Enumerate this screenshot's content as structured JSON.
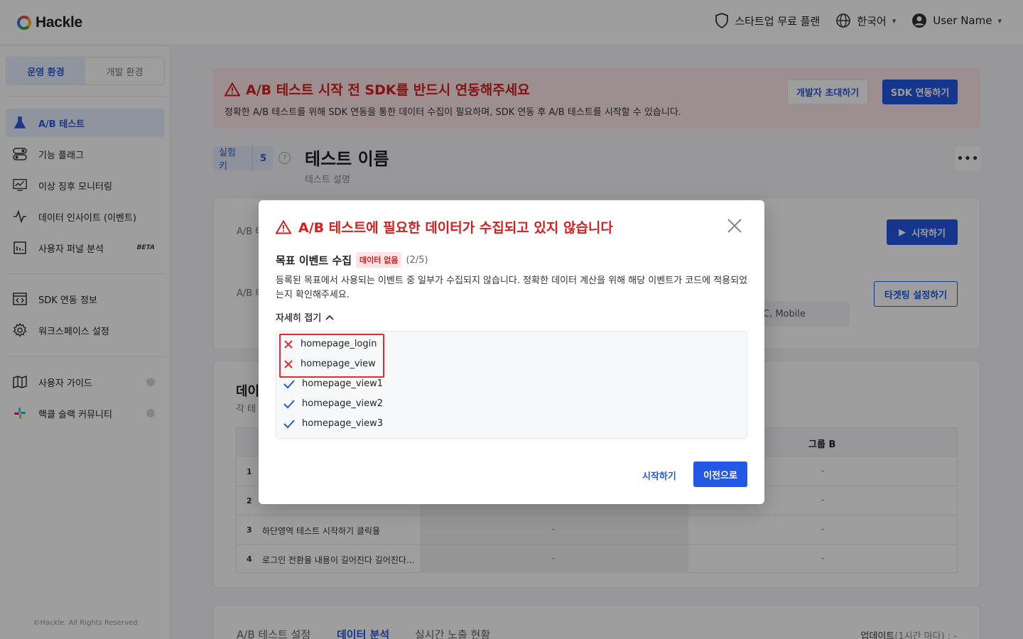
{
  "header": {
    "logo": "Hackle",
    "plan": "스타트업 무료 플랜",
    "language": "한국어",
    "user": "User Name"
  },
  "sidebar": {
    "env_tabs": [
      "운영 환경",
      "개발 환경"
    ],
    "items": [
      {
        "label": "A/B 테스트",
        "icon": "flask-icon"
      },
      {
        "label": "기능 플래그",
        "icon": "toggle-icon"
      },
      {
        "label": "이상 징후 모니터링",
        "icon": "monitor-chart-icon"
      },
      {
        "label": "데이터 인사이트 (이벤트)",
        "icon": "pulse-icon"
      },
      {
        "label": "사용자 퍼널 분석",
        "icon": "bar-chart-icon",
        "badge": "BETA"
      },
      {
        "label": "SDK 연동 정보",
        "icon": "code-window-icon"
      },
      {
        "label": "워크스페이스 설정",
        "icon": "gear-icon"
      },
      {
        "label": "사용자 가이드",
        "icon": "map-icon"
      },
      {
        "label": "핵클 슬랙 커뮤니티",
        "icon": "slack-icon"
      }
    ],
    "copyright": "©Hackle. All Rights Reserved"
  },
  "banner": {
    "title": "A/B 테스트 시작 전 SDK를 반드시 연동해주세요",
    "desc": "정확한 A/B 테스트를 위해 SDK 연동을 통한 데이터 수집이 필요하며, SDK 연동 후 A/B 테스트를 시작할 수 있습니다.",
    "invite_button": "개발자 초대하기",
    "sdk_button": "SDK 연동하기"
  },
  "test": {
    "key_label": "실험 키",
    "key_value": "5",
    "help": "?",
    "title": "테스트 이름",
    "desc": "테스트 설명",
    "more": "•••"
  },
  "info_card": {
    "label1": "A/B 테",
    "label2": "A/B 테",
    "start_button": "시작하기",
    "target_button": "타겟팅 설정하기",
    "platform": "C, Mobile"
  },
  "data_section": {
    "title": "데이",
    "subtitle": "각 테",
    "group_b": "그룹 B",
    "rows": [
      {
        "num": "1",
        "name": "",
        "a": "",
        "b": "-"
      },
      {
        "num": "2",
        "name": "",
        "a": "",
        "b": "-"
      },
      {
        "num": "3",
        "name": "하단영역 테스트 시작하기 클릭율",
        "a": "-",
        "b": "-"
      },
      {
        "num": "4",
        "name": "로그인 전환율 내용이 길어진다 길어진다...",
        "a": "-",
        "b": "-"
      }
    ]
  },
  "bottom_tabs": {
    "tabs": [
      "A/B 테스트 설정",
      "데이터 분석",
      "실시간 노출 현황"
    ],
    "update_label": "업데이트",
    "update_period": "(1시간 마다) : -"
  },
  "modal": {
    "title": "A/B 테스트에 필요한 데이터가 수집되고 있지 않습니다",
    "subtitle": "목표 이벤트 수집",
    "badge": "데이터 없음",
    "count": "(2/5)",
    "desc": "등록된 목표에서 사용되는 이벤트 중 일부가 수집되지 않습니다. 정확한 데이터 계산을 위해 해당 이벤트가 코드에 적용되었는지 확인해주세요.",
    "toggle": "자세히 접기",
    "events": [
      {
        "name": "homepage_login",
        "status": "missing"
      },
      {
        "name": "homepage_view",
        "status": "missing"
      },
      {
        "name": "homepage_view1",
        "status": "ok"
      },
      {
        "name": "homepage_view2",
        "status": "ok"
      },
      {
        "name": "homepage_view3",
        "status": "ok"
      }
    ],
    "start_button": "시작하기",
    "prev_button": "이전으로"
  },
  "colors": {
    "primary": "#2258e4",
    "danger": "#d32020",
    "active_bg": "#e8efff"
  }
}
